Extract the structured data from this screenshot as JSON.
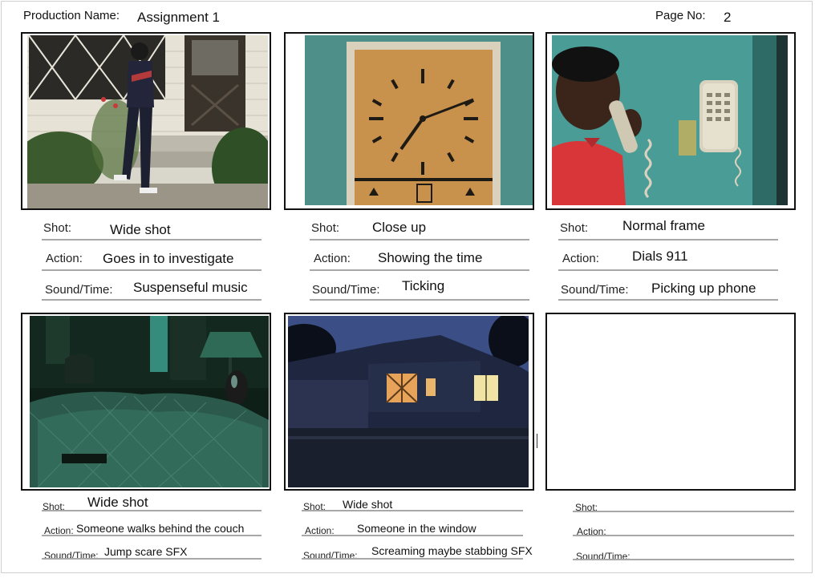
{
  "header": {
    "production_name_label": "Production Name:",
    "production_name_value": "Assignment 1",
    "page_no_label": "Page No:",
    "page_no_value": "2"
  },
  "frames": [
    {
      "image": "boy-walking-to-house",
      "shot_label": "Shot:",
      "shot_value": "Wide shot",
      "action_label": "Action:",
      "action_value": "Goes in to investigate",
      "sound_label": "Sound/Time:",
      "sound_value": "Suspenseful music"
    },
    {
      "image": "wall-clock",
      "shot_label": "Shot:",
      "shot_value": "Close up",
      "action_label": "Action:",
      "action_value": "Showing the time",
      "sound_label": "Sound/Time:",
      "sound_value": "Ticking"
    },
    {
      "image": "boy-on-wall-phone",
      "shot_label": "Shot:",
      "shot_value": "Normal frame",
      "action_label": "Action:",
      "action_value": "Dials 911",
      "sound_label": "Sound/Time:",
      "sound_value": "Picking up phone"
    },
    {
      "image": "dark-living-room-couch",
      "shot_label": "Shot:",
      "shot_value": "Wide shot",
      "action_label": "Action:",
      "action_value": "Someone walks behind the couch",
      "sound_label": "Sound/Time:",
      "sound_value": "Jump scare SFX"
    },
    {
      "image": "house-at-night",
      "shot_label": "Shot:",
      "shot_value": "Wide shot",
      "action_label": "Action:",
      "action_value": "Someone in the window",
      "sound_label": "Sound/Time:",
      "sound_value": "Screaming maybe stabbing SFX"
    },
    {
      "image": "empty-frame",
      "shot_label": "Shot:",
      "shot_value": "",
      "action_label": "Action:",
      "action_value": "",
      "sound_label": "Sound/Time:",
      "sound_value": ""
    }
  ]
}
